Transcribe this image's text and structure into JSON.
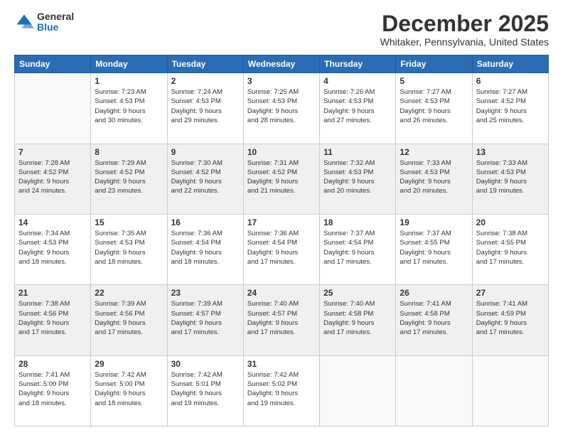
{
  "header": {
    "logo_general": "General",
    "logo_blue": "Blue",
    "month_title": "December 2025",
    "location": "Whitaker, Pennsylvania, United States"
  },
  "days_of_week": [
    "Sunday",
    "Monday",
    "Tuesday",
    "Wednesday",
    "Thursday",
    "Friday",
    "Saturday"
  ],
  "weeks": [
    [
      {
        "day": "",
        "info": ""
      },
      {
        "day": "1",
        "info": "Sunrise: 7:23 AM\nSunset: 4:53 PM\nDaylight: 9 hours\nand 30 minutes."
      },
      {
        "day": "2",
        "info": "Sunrise: 7:24 AM\nSunset: 4:53 PM\nDaylight: 9 hours\nand 29 minutes."
      },
      {
        "day": "3",
        "info": "Sunrise: 7:25 AM\nSunset: 4:53 PM\nDaylight: 9 hours\nand 28 minutes."
      },
      {
        "day": "4",
        "info": "Sunrise: 7:26 AM\nSunset: 4:53 PM\nDaylight: 9 hours\nand 27 minutes."
      },
      {
        "day": "5",
        "info": "Sunrise: 7:27 AM\nSunset: 4:53 PM\nDaylight: 9 hours\nand 26 minutes."
      },
      {
        "day": "6",
        "info": "Sunrise: 7:27 AM\nSunset: 4:52 PM\nDaylight: 9 hours\nand 25 minutes."
      }
    ],
    [
      {
        "day": "7",
        "info": "Sunrise: 7:28 AM\nSunset: 4:52 PM\nDaylight: 9 hours\nand 24 minutes."
      },
      {
        "day": "8",
        "info": "Sunrise: 7:29 AM\nSunset: 4:52 PM\nDaylight: 9 hours\nand 23 minutes."
      },
      {
        "day": "9",
        "info": "Sunrise: 7:30 AM\nSunset: 4:52 PM\nDaylight: 9 hours\nand 22 minutes."
      },
      {
        "day": "10",
        "info": "Sunrise: 7:31 AM\nSunset: 4:52 PM\nDaylight: 9 hours\nand 21 minutes."
      },
      {
        "day": "11",
        "info": "Sunrise: 7:32 AM\nSunset: 4:53 PM\nDaylight: 9 hours\nand 20 minutes."
      },
      {
        "day": "12",
        "info": "Sunrise: 7:33 AM\nSunset: 4:53 PM\nDaylight: 9 hours\nand 20 minutes."
      },
      {
        "day": "13",
        "info": "Sunrise: 7:33 AM\nSunset: 4:53 PM\nDaylight: 9 hours\nand 19 minutes."
      }
    ],
    [
      {
        "day": "14",
        "info": "Sunrise: 7:34 AM\nSunset: 4:53 PM\nDaylight: 9 hours\nand 18 minutes."
      },
      {
        "day": "15",
        "info": "Sunrise: 7:35 AM\nSunset: 4:53 PM\nDaylight: 9 hours\nand 18 minutes."
      },
      {
        "day": "16",
        "info": "Sunrise: 7:36 AM\nSunset: 4:54 PM\nDaylight: 9 hours\nand 18 minutes."
      },
      {
        "day": "17",
        "info": "Sunrise: 7:36 AM\nSunset: 4:54 PM\nDaylight: 9 hours\nand 17 minutes."
      },
      {
        "day": "18",
        "info": "Sunrise: 7:37 AM\nSunset: 4:54 PM\nDaylight: 9 hours\nand 17 minutes."
      },
      {
        "day": "19",
        "info": "Sunrise: 7:37 AM\nSunset: 4:55 PM\nDaylight: 9 hours\nand 17 minutes."
      },
      {
        "day": "20",
        "info": "Sunrise: 7:38 AM\nSunset: 4:55 PM\nDaylight: 9 hours\nand 17 minutes."
      }
    ],
    [
      {
        "day": "21",
        "info": "Sunrise: 7:38 AM\nSunset: 4:56 PM\nDaylight: 9 hours\nand 17 minutes."
      },
      {
        "day": "22",
        "info": "Sunrise: 7:39 AM\nSunset: 4:56 PM\nDaylight: 9 hours\nand 17 minutes."
      },
      {
        "day": "23",
        "info": "Sunrise: 7:39 AM\nSunset: 4:57 PM\nDaylight: 9 hours\nand 17 minutes."
      },
      {
        "day": "24",
        "info": "Sunrise: 7:40 AM\nSunset: 4:57 PM\nDaylight: 9 hours\nand 17 minutes."
      },
      {
        "day": "25",
        "info": "Sunrise: 7:40 AM\nSunset: 4:58 PM\nDaylight: 9 hours\nand 17 minutes."
      },
      {
        "day": "26",
        "info": "Sunrise: 7:41 AM\nSunset: 4:58 PM\nDaylight: 9 hours\nand 17 minutes."
      },
      {
        "day": "27",
        "info": "Sunrise: 7:41 AM\nSunset: 4:59 PM\nDaylight: 9 hours\nand 17 minutes."
      }
    ],
    [
      {
        "day": "28",
        "info": "Sunrise: 7:41 AM\nSunset: 5:00 PM\nDaylight: 9 hours\nand 18 minutes."
      },
      {
        "day": "29",
        "info": "Sunrise: 7:42 AM\nSunset: 5:00 PM\nDaylight: 9 hours\nand 18 minutes."
      },
      {
        "day": "30",
        "info": "Sunrise: 7:42 AM\nSunset: 5:01 PM\nDaylight: 9 hours\nand 19 minutes."
      },
      {
        "day": "31",
        "info": "Sunrise: 7:42 AM\nSunset: 5:02 PM\nDaylight: 9 hours\nand 19 minutes."
      },
      {
        "day": "",
        "info": ""
      },
      {
        "day": "",
        "info": ""
      },
      {
        "day": "",
        "info": ""
      }
    ]
  ]
}
